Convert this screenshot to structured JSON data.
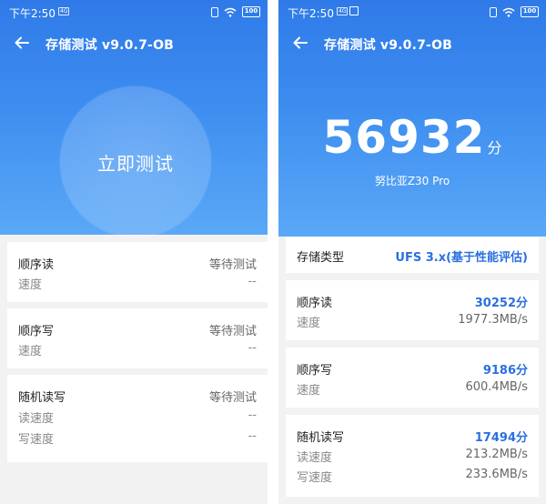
{
  "status_bar": {
    "time": "下午2:50",
    "net_tag": "4G",
    "battery": "100"
  },
  "app": {
    "title": "存储测试 v9.0.7-OB"
  },
  "left": {
    "button_label": "立即测试",
    "sections": [
      {
        "name": "顺序读",
        "status": "等待测试",
        "rows": [
          {
            "label": "速度",
            "value": "--"
          }
        ]
      },
      {
        "name": "顺序写",
        "status": "等待测试",
        "rows": [
          {
            "label": "速度",
            "value": "--"
          }
        ]
      },
      {
        "name": "随机读写",
        "status": "等待测试",
        "rows": [
          {
            "label": "读速度",
            "value": "--"
          },
          {
            "label": "写速度",
            "value": "--"
          }
        ]
      }
    ]
  },
  "right": {
    "score": "56932",
    "score_unit": "分",
    "device": "努比亚Z30 Pro",
    "storage_type": {
      "label": "存储类型",
      "value": "UFS 3.x(基于性能评估)"
    },
    "sections": [
      {
        "name": "顺序读",
        "score": "30252分",
        "rows": [
          {
            "label": "速度",
            "value": "1977.3MB/s"
          }
        ]
      },
      {
        "name": "顺序写",
        "score": "9186分",
        "rows": [
          {
            "label": "速度",
            "value": "600.4MB/s"
          }
        ]
      },
      {
        "name": "随机读写",
        "score": "17494分",
        "rows": [
          {
            "label": "读速度",
            "value": "213.2MB/s"
          },
          {
            "label": "写速度",
            "value": "233.6MB/s"
          }
        ]
      }
    ]
  },
  "colors": {
    "accent": "#2a6fe0",
    "hero_top": "#2f7ae8",
    "hero_bottom": "#5aa8f7"
  }
}
